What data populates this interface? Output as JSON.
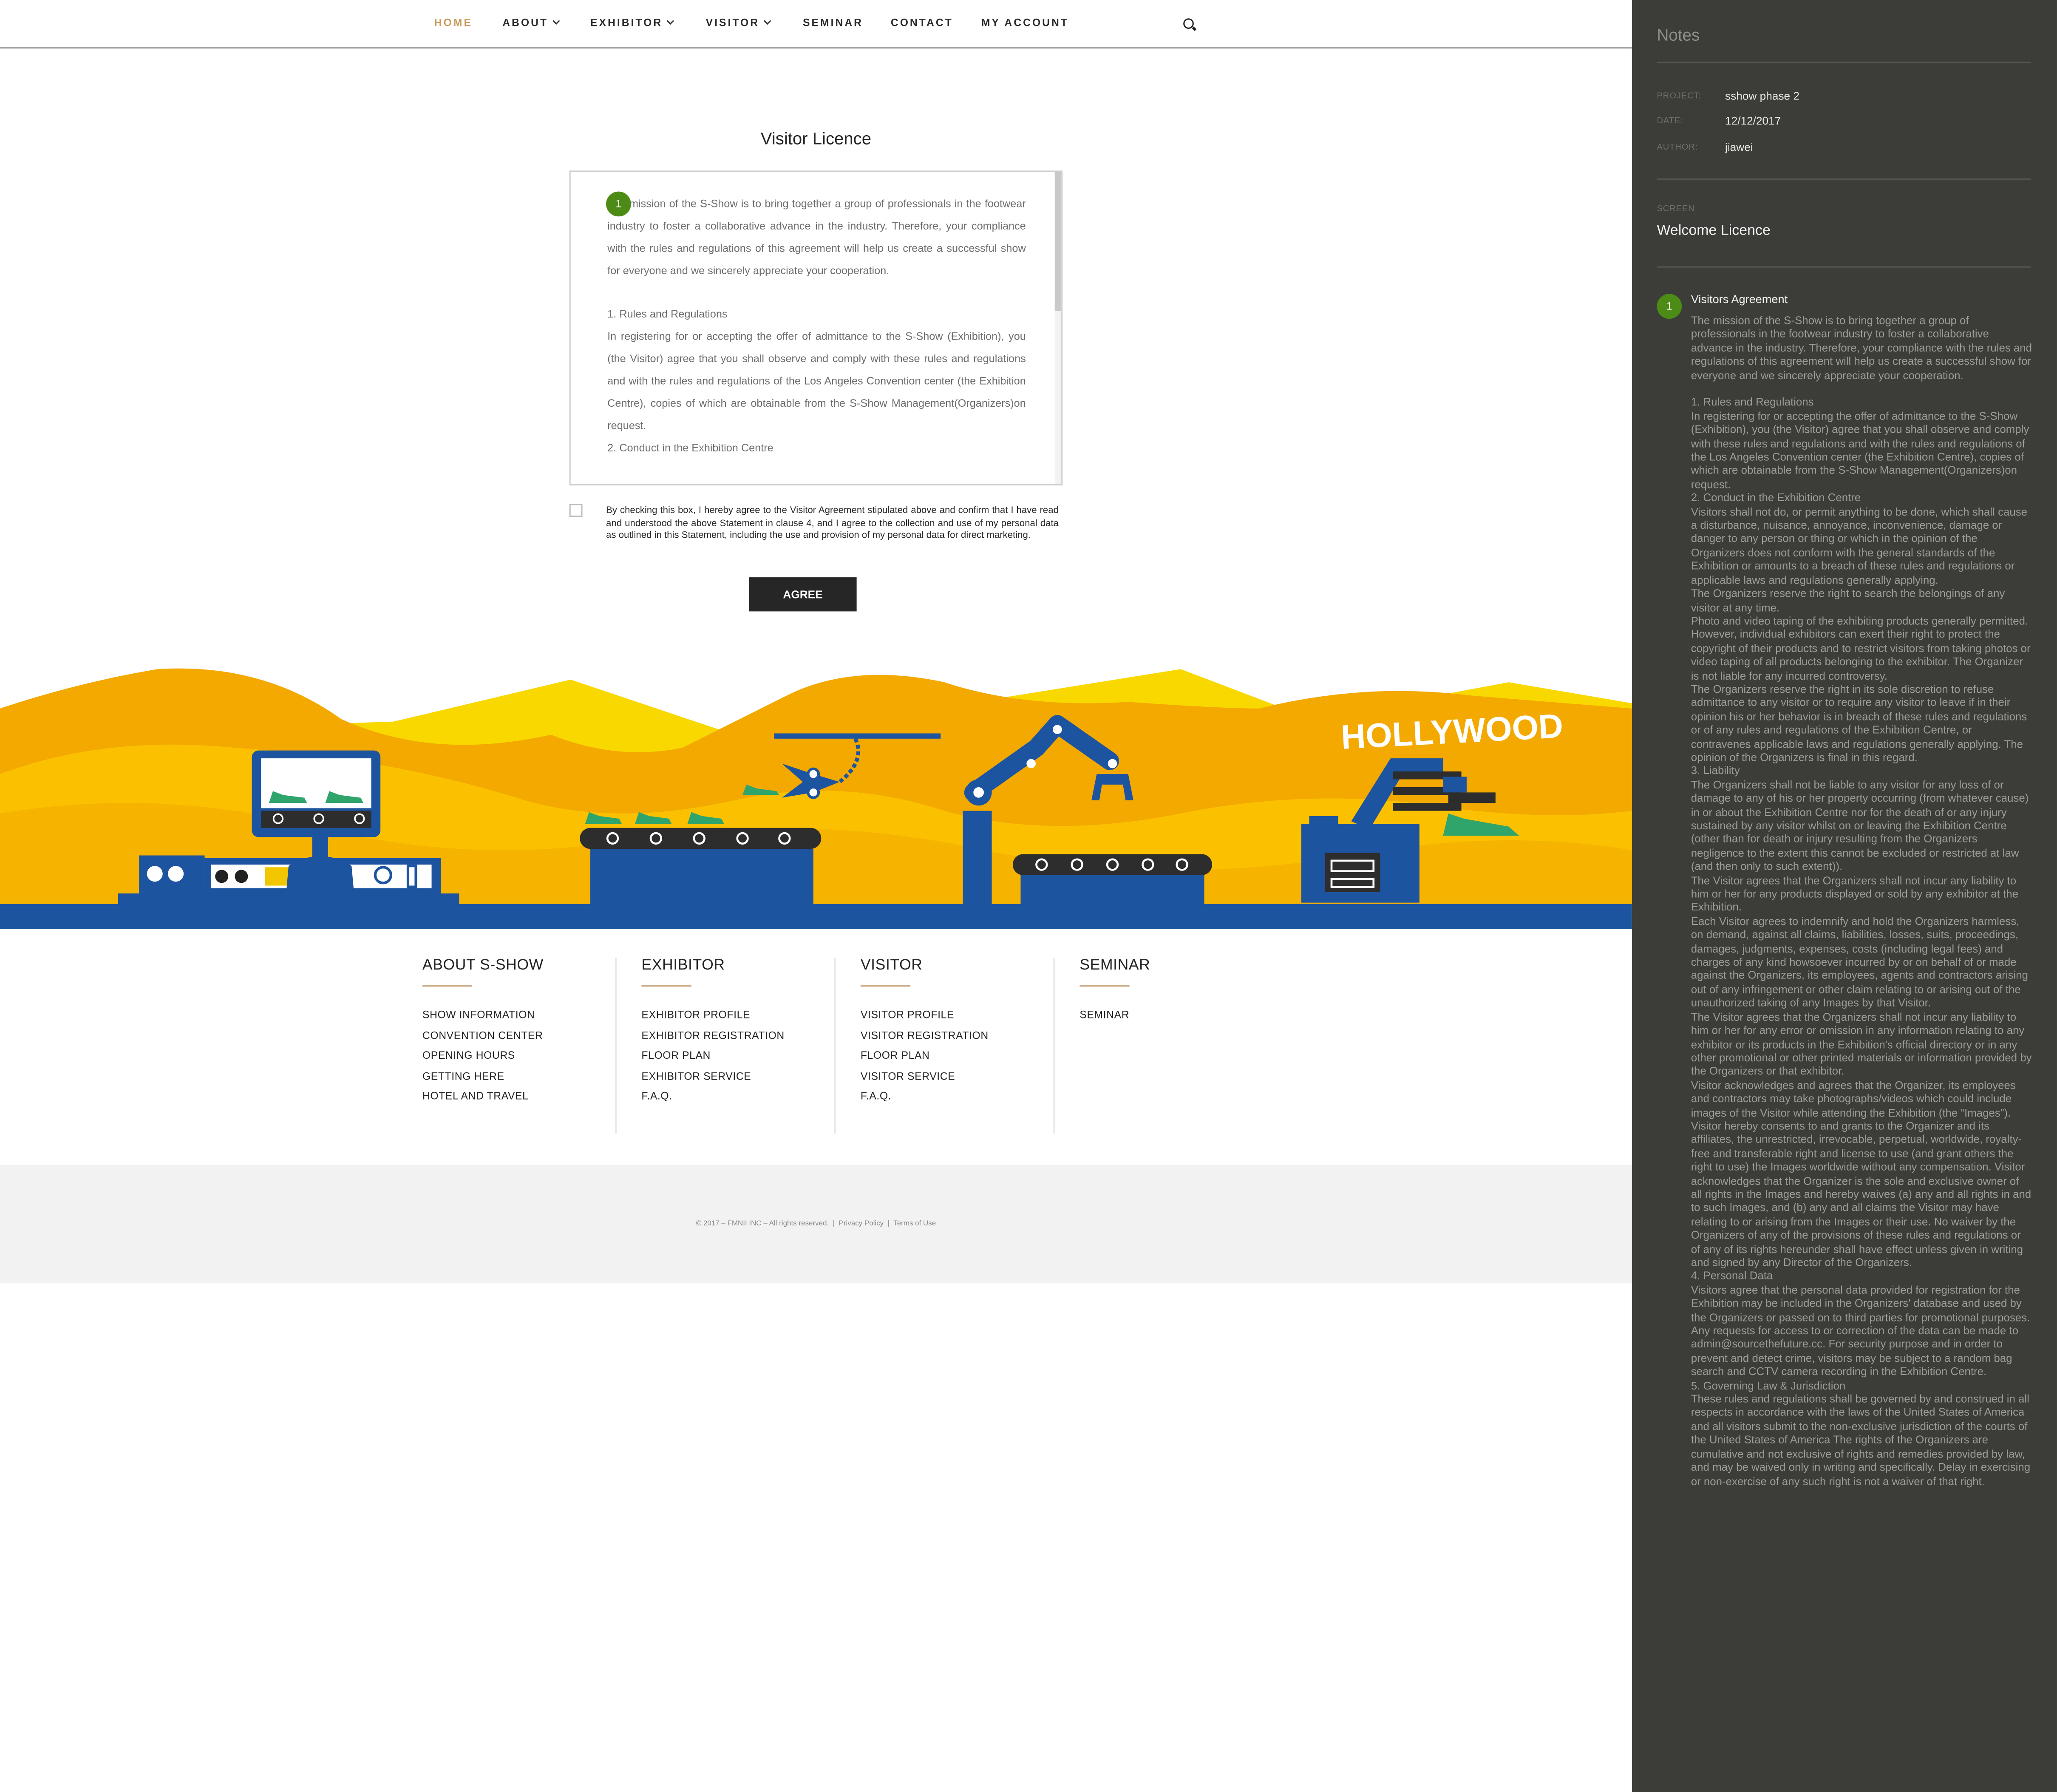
{
  "nav": {
    "home": "HOME",
    "about": "ABOUT",
    "exhibitor": "EXHIBITOR",
    "visitor": "VISITOR",
    "seminar": "SEMINAR",
    "contact": "CONTACT",
    "account": "MY ACCOUNT"
  },
  "page": {
    "title": "Visitor Licence",
    "pin_number": "1",
    "licence_intro": "mission of the S-Show is to bring together a group of professionals in the footwear industry to foster a collaborative advance in the industry. Therefore, your compliance with the rules and regulations of this agreement will help us create a successful show for everyone and we sincerely appreciate your cooperation.",
    "licence_sec1": "1. Rules and Regulations",
    "licence_sec1_body": "In registering for or accepting the offer of admittance to the S-Show (Exhibition), you (the Visitor) agree that you shall observe and comply with these rules and regulations and with the rules and regulations of the Los Angeles Convention center (the Exhibition Centre), copies of which are obtainable from the S-Show Management(Organizers)on request.",
    "licence_sec2": "2. Conduct in the Exhibition Centre",
    "agree_statement": "By checking this box, I hereby agree to the Visitor Agreement stipulated above and confirm that I have read and understood the above Statement in clause 4, and I agree to the collection and use of my personal data as outlined in this Statement, including the use and provision of my personal data for direct marketing.",
    "agree_button": "AGREE",
    "hollywood": "HOLLYWOOD"
  },
  "footer": {
    "columns": [
      {
        "heading": "ABOUT S-SHOW",
        "links": [
          "SHOW INFORMATION",
          "CONVENTION CENTER",
          "OPENING HOURS",
          "GETTING HERE",
          "HOTEL AND TRAVEL"
        ]
      },
      {
        "heading": "EXHIBITOR",
        "links": [
          "EXHIBITOR PROFILE",
          "EXHIBITOR REGISTRATION",
          "FLOOR PLAN",
          "EXHIBITOR SERVICE",
          "F.A.Q."
        ]
      },
      {
        "heading": "VISITOR",
        "links": [
          "VISITOR PROFILE",
          "VISITOR REGISTRATION",
          "FLOOR PLAN",
          "VISITOR SERVICE",
          "F.A.Q."
        ]
      },
      {
        "heading": "SEMINAR",
        "links": [
          "SEMINAR"
        ]
      }
    ],
    "copyright": "© 2017 – FMNII INC – All rights reserved.",
    "sep": "|",
    "privacy": "Privacy Policy",
    "terms": "Terms of Use"
  },
  "notes": {
    "title": "Notes",
    "project_label": "PROJECT:",
    "project": "sshow phase 2",
    "date_label": "DATE:",
    "date": "12/12/2017",
    "author_label": "AUTHOR:",
    "author": "jiawei",
    "screen_label": "SCREEN",
    "screen": "Welcome Licence",
    "pin_number": "1",
    "heading": "Visitors Agreement",
    "paragraphs": [
      "The mission of the S-Show is to bring together a group of professionals in the footwear industry to foster a collaborative advance in the industry. Therefore, your compliance with the rules and regulations of this agreement will help us create a successful show for everyone and we sincerely appreciate your cooperation.",
      "1. Rules and Regulations",
      "In registering for or accepting the offer of admittance to the S-Show (Exhibition), you (the Visitor) agree that you shall observe and comply with these rules and regulations and with the rules and regulations of the Los Angeles Convention center (the Exhibition Centre), copies of which are obtainable from the S-Show Management(Organizers)on request.",
      "2. Conduct in the Exhibition Centre",
      "Visitors shall not do, or permit anything to be done, which shall cause a disturbance, nuisance, annoyance, inconvenience, damage or danger to any person or thing or which in the opinion of the Organizers does not conform with the general standards of the Exhibition or amounts to a breach of these rules and regulations or applicable laws and regulations generally applying.",
      "The Organizers reserve the right to search the belongings of any visitor at any time.",
      "Photo and video taping of the exhibiting products generally permitted. However, individual exhibitors can exert their right to protect the copyright of their products and to restrict visitors from taking photos or video taping of all products belonging to the exhibitor. The Organizer is not liable for any incurred controversy.",
      "The Organizers reserve the right in its sole discretion to refuse admittance to any visitor or to require any visitor to leave if in their opinion his or her behavior is in breach of these rules and regulations or of any rules and regulations of the Exhibition Centre, or contravenes applicable laws and regulations generally applying. The opinion of the Organizers is final in this regard.",
      "3. Liability",
      "The Organizers shall not be liable to any visitor for any loss of or damage to any of his or her property occurring (from whatever cause) in or about the Exhibition Centre nor for the death of or any injury sustained by any visitor whilst on or leaving the Exhibition Centre (other than for death or injury resulting from the Organizers negligence to the extent this cannot be excluded or restricted at law (and then only to such extent)).",
      "The Visitor agrees that the Organizers shall not incur any liability to him or her for any products displayed or sold by any exhibitor at the Exhibition.",
      "Each Visitor agrees to indemnify and hold the Organizers harmless, on demand, against all claims, liabilities, losses, suits, proceedings, damages, judgments, expenses, costs (including legal fees) and charges of any kind howsoever incurred by or on behalf of or made against the Organizers, its employees, agents and contractors arising out of any infringement or other claim relating to or arising out of the unauthorized taking of any Images by that Visitor.",
      "The Visitor agrees that the Organizers shall not incur any liability to him or her for any error or omission in any information relating to any exhibitor or its products in the Exhibition's official directory or in any other promotional or other printed materials or information provided by the Organizers or that exhibitor.",
      "Visitor acknowledges and agrees that the Organizer, its employees and contractors may take photographs/videos which could include images of the Visitor while attending the Exhibition (the “Images”). Visitor hereby consents to and grants to the Organizer and its affiliates, the unrestricted, irrevocable, perpetual, worldwide, royalty-free and transferable right and license to use (and grant others the right to use) the Images worldwide without any compensation. Visitor acknowledges that the Organizer is the sole and exclusive owner of all rights in the Images and hereby waives (a) any and all rights in and to such Images, and (b) any and all claims the Visitor may have relating to or arising from the Images or their use. No waiver by the Organizers of any of the provisions of these rules and regulations or of any of its rights hereunder shall have effect unless given in writing and signed by any Director of the Organizers.",
      "4. Personal Data",
      "Visitors agree that the personal data provided for registration for the Exhibition may be included in the Organizers' database and used by the Organizers or passed on to third parties for promotional purposes. Any requests for access to or correction of the data can be made to admin@sourcethefuture.cc. For security purpose and in order to prevent and detect crime, visitors may be subject to a random bag search and CCTV camera recording in the Exhibition Centre.",
      "5. Governing Law & Jurisdiction",
      "These rules and regulations shall be governed by and construed in all respects in accordance with the laws of the United States of America and all visitors submit to the non-exclusive jurisdiction of the courts of the United States of America The rights of the Organizers are cumulative and not exclusive of rights and remedies provided by law, and may be waived only in writing and specifically. Delay in exercising or non-exercise of any such right is not a waiver of that right."
    ]
  },
  "colors": {
    "accent": "#c79a5b",
    "pin_green": "#4c8c16",
    "notes_bg": "#3c3d38",
    "mountain_orange": "#f0a500",
    "mountain_yellow": "#f9c400",
    "machine_blue": "#1d54a0"
  }
}
